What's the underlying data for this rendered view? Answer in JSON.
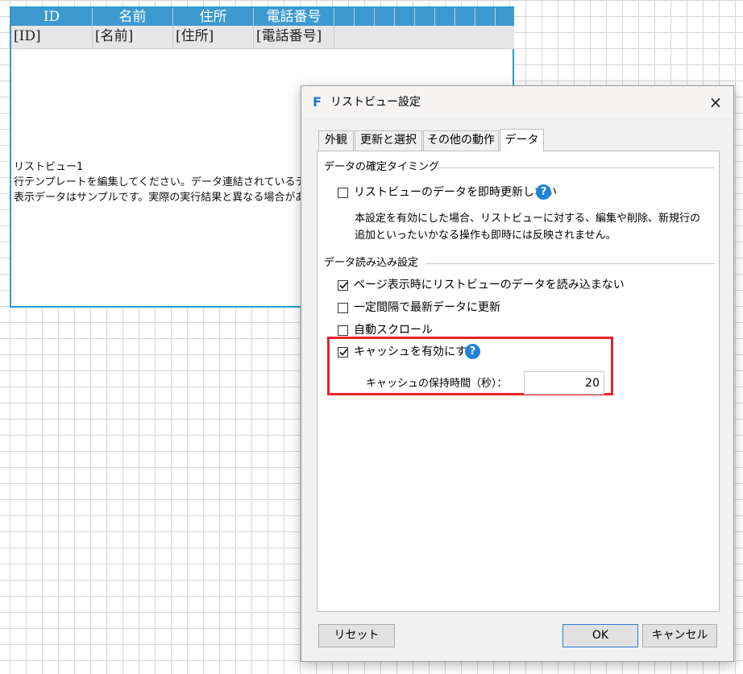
{
  "listview": {
    "columns": [
      "ID",
      "名前",
      "住所",
      "電話番号"
    ],
    "placeholders": [
      "[ID]",
      "[名前]",
      "[住所]",
      "[電話番号]"
    ],
    "description_lines": [
      "リストビュー1",
      "行テンプレートを編集してください。データ連結されているテーブル",
      "表示データはサンプルです。実際の実行結果と異なる場合があ"
    ],
    "header_color": "#3c9ad0",
    "border_color": "#2b9ad5"
  },
  "dialog": {
    "title": "リストビュー設定",
    "app_icon": "F",
    "close_icon": "×",
    "tabs": [
      {
        "label": "外観",
        "active": false
      },
      {
        "label": "更新と選択",
        "active": false
      },
      {
        "label": "その他の動作",
        "active": false
      },
      {
        "label": "データ",
        "active": true
      }
    ],
    "section1": {
      "title": "データの確定タイミング",
      "checkbox": {
        "label": "リストビューのデータを即時更新しない",
        "checked": false
      },
      "note_lines": [
        "本設定を有効にした場合、リストビューに対する、編集や削除、新規行の",
        "追加といったいかなる操作も即時には反映されません。"
      ]
    },
    "section2": {
      "title": "データ読み込み設定",
      "checkboxes": [
        {
          "label": "ページ表示時にリストビューのデータを読み込まない",
          "checked": true
        },
        {
          "label": "一定間隔で最新データに更新",
          "checked": false
        },
        {
          "label": "自動スクロール",
          "checked": false
        },
        {
          "label": "キャッシュを有効にする",
          "checked": true
        }
      ],
      "cache_hold_label": "キャッシュの保持時間（秒）：",
      "cache_hold_value": "20"
    },
    "help_icon": "?",
    "buttons": {
      "reset": "リセット",
      "ok": "OK",
      "cancel": "キャンセル"
    },
    "highlight_color": "#e8232a",
    "accent_color": "#1f83d8"
  }
}
